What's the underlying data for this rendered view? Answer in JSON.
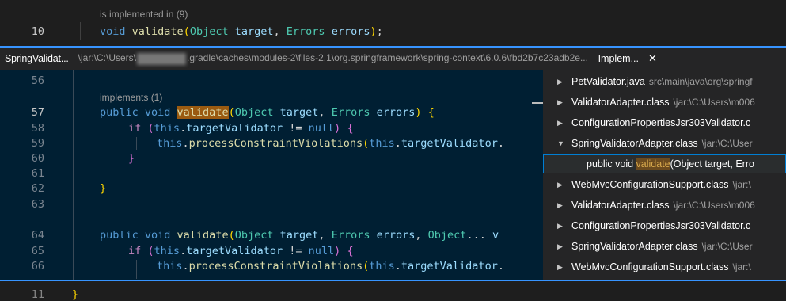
{
  "top": {
    "codelens": "is implemented in (9)",
    "line_number": "10",
    "code": [
      {
        "t": "void ",
        "c": "kw"
      },
      {
        "t": "validate",
        "c": "fn"
      },
      {
        "t": "(",
        "c": "br1"
      },
      {
        "t": "Object",
        "c": "ty"
      },
      {
        "t": " ",
        "c": ""
      },
      {
        "t": "target",
        "c": "var"
      },
      {
        "t": ", ",
        "c": ""
      },
      {
        "t": "Errors",
        "c": "ty"
      },
      {
        "t": " ",
        "c": ""
      },
      {
        "t": "errors",
        "c": "var"
      },
      {
        "t": ")",
        "c": "br1"
      },
      {
        "t": ";",
        "c": ""
      }
    ]
  },
  "peek": {
    "title": "SpringValidat...",
    "path_prefix": "\\jar:\\C:\\Users\\",
    "path_suffix": ".gradle\\caches\\modules-2\\files-2.1\\org.springframework\\spring-context\\6.0.6\\fbd2b7c23adb2e...",
    "kind": "- Implem...",
    "close_glyph": "✕",
    "accent_color": "#3794ff",
    "editor": {
      "codelens": "implements (1)",
      "lines": [
        {
          "n": "56",
          "code": []
        },
        {
          "n": "57",
          "code": [
            {
              "t": "public void ",
              "c": "kw"
            },
            {
              "t": "validate",
              "c": "hl"
            },
            {
              "t": "(",
              "c": "br1"
            },
            {
              "t": "Object",
              "c": "ty"
            },
            {
              "t": " ",
              "c": ""
            },
            {
              "t": "target",
              "c": "var"
            },
            {
              "t": ", ",
              "c": ""
            },
            {
              "t": "Errors",
              "c": "ty"
            },
            {
              "t": " ",
              "c": ""
            },
            {
              "t": "errors",
              "c": "var"
            },
            {
              "t": ")",
              "c": "br1"
            },
            {
              "t": " ",
              "c": ""
            },
            {
              "t": "{",
              "c": "br1"
            }
          ]
        },
        {
          "n": "58",
          "code": [
            {
              "t": "if",
              "c": "kw2"
            },
            {
              "t": " ",
              "c": ""
            },
            {
              "t": "(",
              "c": "br2"
            },
            {
              "t": "this",
              "c": "kw"
            },
            {
              "t": ".",
              "c": ""
            },
            {
              "t": "targetValidator",
              "c": "var"
            },
            {
              "t": " != ",
              "c": ""
            },
            {
              "t": "null",
              "c": "kw"
            },
            {
              "t": ")",
              "c": "br2"
            },
            {
              "t": " ",
              "c": ""
            },
            {
              "t": "{",
              "c": "br2"
            }
          ]
        },
        {
          "n": "59",
          "code": [
            {
              "t": "this",
              "c": "kw"
            },
            {
              "t": ".",
              "c": ""
            },
            {
              "t": "processConstraintViolations",
              "c": "fn"
            },
            {
              "t": "(",
              "c": "br1"
            },
            {
              "t": "this",
              "c": "kw"
            },
            {
              "t": ".",
              "c": ""
            },
            {
              "t": "targetValidator",
              "c": "var"
            },
            {
              "t": ".",
              "c": ""
            }
          ]
        },
        {
          "n": "60",
          "code": [
            {
              "t": "}",
              "c": "br2"
            }
          ]
        },
        {
          "n": "61",
          "code": []
        },
        {
          "n": "62",
          "code": [
            {
              "t": "}",
              "c": "br1"
            }
          ]
        },
        {
          "n": "63",
          "code": []
        },
        {
          "n": "64",
          "code": [
            {
              "t": "public void ",
              "c": "kw"
            },
            {
              "t": "validate",
              "c": "fn"
            },
            {
              "t": "(",
              "c": "br1"
            },
            {
              "t": "Object",
              "c": "ty"
            },
            {
              "t": " ",
              "c": ""
            },
            {
              "t": "target",
              "c": "var"
            },
            {
              "t": ", ",
              "c": ""
            },
            {
              "t": "Errors",
              "c": "ty"
            },
            {
              "t": " ",
              "c": ""
            },
            {
              "t": "errors",
              "c": "var"
            },
            {
              "t": ", ",
              "c": ""
            },
            {
              "t": "Object",
              "c": "ty"
            },
            {
              "t": "... ",
              "c": ""
            },
            {
              "t": "v",
              "c": "var"
            }
          ]
        },
        {
          "n": "65",
          "code": [
            {
              "t": "if",
              "c": "kw2"
            },
            {
              "t": " ",
              "c": ""
            },
            {
              "t": "(",
              "c": "br2"
            },
            {
              "t": "this",
              "c": "kw"
            },
            {
              "t": ".",
              "c": ""
            },
            {
              "t": "targetValidator",
              "c": "var"
            },
            {
              "t": " != ",
              "c": ""
            },
            {
              "t": "null",
              "c": "kw"
            },
            {
              "t": ")",
              "c": "br2"
            },
            {
              "t": " ",
              "c": ""
            },
            {
              "t": "{",
              "c": "br2"
            }
          ]
        },
        {
          "n": "66",
          "code": [
            {
              "t": "this",
              "c": "kw"
            },
            {
              "t": ".",
              "c": ""
            },
            {
              "t": "processConstraintViolations",
              "c": "fn"
            },
            {
              "t": "(",
              "c": "br1"
            },
            {
              "t": "this",
              "c": "kw"
            },
            {
              "t": ".",
              "c": ""
            },
            {
              "t": "targetValidator",
              "c": "var"
            },
            {
              "t": ".",
              "c": ""
            }
          ]
        }
      ]
    },
    "references": [
      {
        "twisty": "▶",
        "name": "PetValidator.java",
        "path": "src\\main\\java\\org\\springf"
      },
      {
        "twisty": "▶",
        "name": "ValidatorAdapter.class",
        "path": "\\jar:\\C:\\Users\\m006"
      },
      {
        "twisty": "▶",
        "name": "ConfigurationPropertiesJsr303Validator.c",
        "path": ""
      },
      {
        "twisty": "▼",
        "name": "SpringValidatorAdapter.class",
        "path": "\\jar:\\C:\\User"
      },
      {
        "child": true,
        "before": "public void ",
        "match": "validate",
        "after": "(Object target, Erro"
      },
      {
        "twisty": "▶",
        "name": "WebMvcConfigurationSupport.class",
        "path": "\\jar:\\"
      },
      {
        "twisty": "▶",
        "name": "ValidatorAdapter.class",
        "path": "\\jar:\\C:\\Users\\m006"
      },
      {
        "twisty": "▶",
        "name": "ConfigurationPropertiesJsr303Validator.c",
        "path": ""
      },
      {
        "twisty": "▶",
        "name": "SpringValidatorAdapter.class",
        "path": "\\jar:\\C:\\User"
      },
      {
        "twisty": "▶",
        "name": "WebMvcConfigurationSupport.class",
        "path": "\\jar:\\"
      }
    ]
  },
  "bottom": {
    "line_number": "11",
    "code": [
      {
        "t": "}",
        "c": "br1"
      }
    ]
  }
}
